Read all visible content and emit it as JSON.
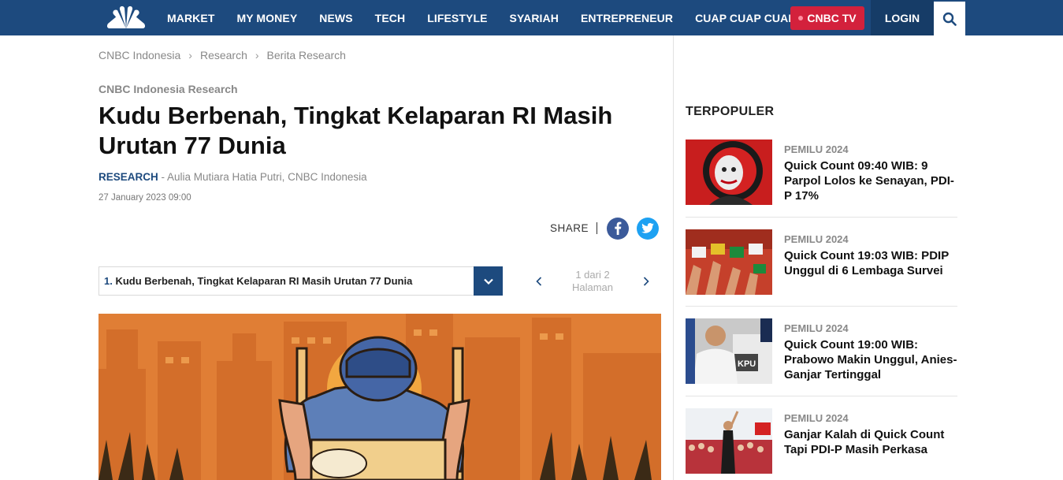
{
  "nav": {
    "items": [
      "MARKET",
      "MY MONEY",
      "NEWS",
      "TECH",
      "LIFESTYLE",
      "SYARIAH",
      "ENTREPRENEUR",
      "CUAP CUAP CUAN"
    ],
    "tv_label": "CNBC TV",
    "login_label": "LOGIN",
    "logo_icon": "nbc-peacock-icon",
    "search_icon": "search-icon"
  },
  "breadcrumb": [
    "CNBC Indonesia",
    "Research",
    "Berita Research"
  ],
  "article": {
    "kicker": "CNBC Indonesia Research",
    "headline": "Kudu Berbenah, Tingkat Kelaparan RI Masih Urutan 77 Dunia",
    "category": "RESEARCH",
    "author": " - Aulia Mutiara Hatia Putri, CNBC Indonesia",
    "date": "27 January 2023 09:00",
    "share_label": "SHARE"
  },
  "page_select": {
    "number": "1.",
    "title": "Kudu Berbenah, Tingkat Kelaparan RI Masih Urutan 77 Dunia"
  },
  "pager": {
    "line1": "1 dari 2",
    "line2": "Halaman"
  },
  "sidebar": {
    "title": "TERPOPULER",
    "items": [
      {
        "category": "PEMILU 2024",
        "title": "Quick Count 09:40 WIB: 9 Parpol Lolos ke Senayan, PDI-P 17%"
      },
      {
        "category": "PEMILU 2024",
        "title": "Quick Count 19:03 WIB: PDIP Unggul di 6 Lembaga Survei"
      },
      {
        "category": "PEMILU 2024",
        "title": "Quick Count 19:00 WIB: Prabowo Makin Unggul, Anies-Ganjar Tertinggal"
      },
      {
        "category": "PEMILU 2024",
        "title": "Ganjar Kalah di Quick Count Tapi PDI-P Masih Perkasa"
      }
    ]
  },
  "colors": {
    "nav_bg": "#1d4a7e",
    "tv_red": "#d3213c",
    "facebook": "#3b5a9a",
    "twitter": "#1da1f2"
  }
}
